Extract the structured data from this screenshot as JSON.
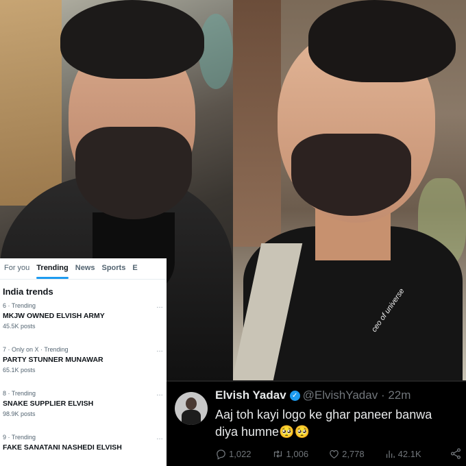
{
  "photos": {
    "watermark": "ceo of universe"
  },
  "trends_panel": {
    "tabs": [
      {
        "label": "For you",
        "active": false
      },
      {
        "label": "Trending",
        "active": true
      },
      {
        "label": "News",
        "active": false
      },
      {
        "label": "Sports",
        "active": false
      },
      {
        "label": "E",
        "active": false
      }
    ],
    "heading": "India trends",
    "items": [
      {
        "meta": "6 · Trending",
        "title": "MKJW OWNED ELVISH ARMY",
        "posts": "45.5K posts"
      },
      {
        "meta": "7 · Only on X · Trending",
        "title": "PARTY STUNNER MUNAWAR",
        "posts": "65.1K posts"
      },
      {
        "meta": "8 · Trending",
        "title": "SNAKE SUPPLIER ELVISH",
        "posts": "98.9K posts"
      },
      {
        "meta": "9 · Trending",
        "title": "FAKE SANATANI NASHEDI ELVISH",
        "posts": ""
      }
    ],
    "more_icon": "…"
  },
  "tweet": {
    "name": "Elvish Yadav",
    "verified_icon": "✓",
    "handle": "@ElvishYadav",
    "time": "· 22m",
    "text": "Aaj toh kayi logo ke ghar paneer banwa diya humne🥺🥺",
    "replies": "1,022",
    "reposts": "1,006",
    "likes": "2,778",
    "views": "42.1K"
  }
}
